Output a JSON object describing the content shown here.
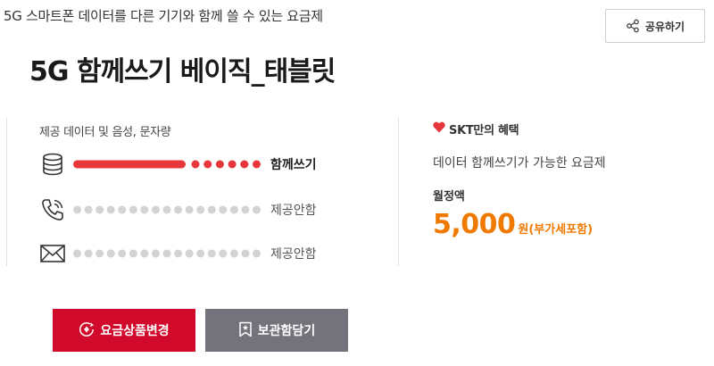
{
  "header": {
    "subtitle": "5G 스마트폰 데이터를 다른 기기와 함께 쓸 수 있는 요금제",
    "share_label": "공유하기",
    "title": "5G 함께쓰기 베이직_태블릿"
  },
  "provision": {
    "section_label": "제공 데이터 및 음성, 문자량",
    "rows": [
      {
        "icon": "database-icon",
        "label": "함께쓰기",
        "active": true,
        "fill_fraction": 0.6
      },
      {
        "icon": "phone-icon",
        "label": "제공안함",
        "active": false,
        "fill_fraction": 0
      },
      {
        "icon": "mail-icon",
        "label": "제공안함",
        "active": false,
        "fill_fraction": 0
      }
    ]
  },
  "benefit": {
    "head": "SKT만의 혜택",
    "description": "데이터 함께쓰기가 가능한 요금제",
    "price_label": "월정액",
    "price_value": "5,000",
    "price_unit": "원(부가세포함)"
  },
  "actions": {
    "change_label": "요금상품변경",
    "save_label": "보관함담기"
  },
  "colors": {
    "accent_red": "#e8363d",
    "brand_red": "#d10a2b",
    "price_orange": "#f07a00",
    "inactive_dot": "#d3d3d3",
    "gray_button": "#74737c"
  }
}
